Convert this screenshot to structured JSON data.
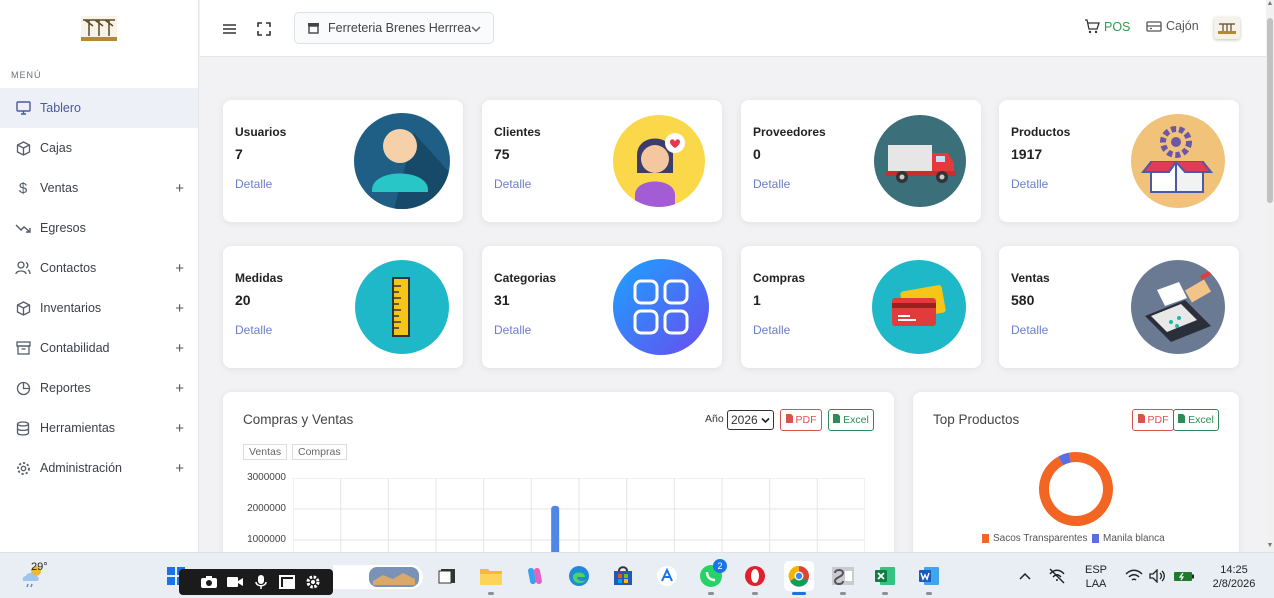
{
  "sidebar": {
    "menu_header": "MENÚ",
    "items": [
      {
        "label": "Tablero",
        "icon": "monitor-icon",
        "expandable": false,
        "active": true
      },
      {
        "label": "Cajas",
        "icon": "box-icon",
        "expandable": false
      },
      {
        "label": "Ventas",
        "icon": "dollar-icon",
        "expandable": true
      },
      {
        "label": "Egresos",
        "icon": "trend-down-icon",
        "expandable": false
      },
      {
        "label": "Contactos",
        "icon": "users-icon",
        "expandable": true
      },
      {
        "label": "Inventarios",
        "icon": "box-icon",
        "expandable": true
      },
      {
        "label": "Contabilidad",
        "icon": "archive-icon",
        "expandable": true
      },
      {
        "label": "Reportes",
        "icon": "pie-chart-icon",
        "expandable": true
      },
      {
        "label": "Herramientas",
        "icon": "database-icon",
        "expandable": true
      },
      {
        "label": "Administración",
        "icon": "gear-icon",
        "expandable": true
      }
    ],
    "plus": "+"
  },
  "topbar": {
    "store_name": "Ferreteria Brenes Herrrea",
    "pos_label": "POS",
    "cajon_label": "Cajón"
  },
  "cards": [
    {
      "title": "Usuarios",
      "value": "7",
      "link": "Detalle",
      "icon": "user-avatar-icon"
    },
    {
      "title": "Clientes",
      "value": "75",
      "link": "Detalle",
      "icon": "customer-heart-icon"
    },
    {
      "title": "Proveedores",
      "value": "0",
      "link": "Detalle",
      "icon": "delivery-truck-icon"
    },
    {
      "title": "Productos",
      "value": "1917",
      "link": "Detalle",
      "icon": "product-box-gear-icon"
    },
    {
      "title": "Medidas",
      "value": "20",
      "link": "Detalle",
      "icon": "ruler-icon"
    },
    {
      "title": "Categorias",
      "value": "31",
      "link": "Detalle",
      "icon": "categories-grid-icon"
    },
    {
      "title": "Compras",
      "value": "1",
      "link": "Detalle",
      "icon": "credit-cards-icon"
    },
    {
      "title": "Ventas",
      "value": "580",
      "link": "Detalle",
      "icon": "card-terminal-icon"
    }
  ],
  "sales_panel": {
    "title": "Compras y Ventas",
    "year_label": "Año",
    "year_value": "2026",
    "pdf_label": "PDF",
    "excel_label": "Excel"
  },
  "top_panel": {
    "title": "Top Productos",
    "pdf_label": "PDF",
    "excel_label": "Excel"
  },
  "chart_data": [
    {
      "type": "bar",
      "title": "Compras y Ventas",
      "series": [
        {
          "name": "Ventas",
          "color": "#4f86e8",
          "values": [
            0,
            0,
            0,
            0,
            0,
            2100000,
            600000,
            0,
            0,
            0,
            0,
            0
          ]
        },
        {
          "name": "Compras",
          "color": "#9aa0a6",
          "values": [
            0,
            0,
            0,
            0,
            0,
            0,
            0,
            0,
            0,
            0,
            0,
            0
          ]
        }
      ],
      "y_ticks": [
        "3000000",
        "2000000",
        "1000000"
      ],
      "ylim": [
        0,
        3000000
      ],
      "grid": true
    },
    {
      "type": "pie",
      "title": "Top Productos",
      "slices": [
        {
          "name": "Sacos Transparentes",
          "value": 95,
          "color": "#f26522"
        },
        {
          "name": "Manila blanca",
          "value": 5,
          "color": "#5b6ee1"
        }
      ]
    }
  ],
  "taskbar": {
    "temperature": "29°",
    "lang_top": "ESP",
    "lang_bottom": "LAA",
    "time": "14:25",
    "date": "2/8/2026",
    "whatsapp_badge": "2",
    "apps": [
      "file-explorer-icon",
      "copilot-icon",
      "edge-icon",
      "store-icon",
      "translate-icon",
      "whatsapp-icon",
      "opera-icon",
      "chrome-icon",
      "sql-icon",
      "excel-icon",
      "word-icon"
    ]
  },
  "colors": {
    "accent": "#6c7fc4",
    "pos_green": "#2e9d4a",
    "pdf_red": "#d9534f",
    "excel_green": "#2e8b57"
  }
}
